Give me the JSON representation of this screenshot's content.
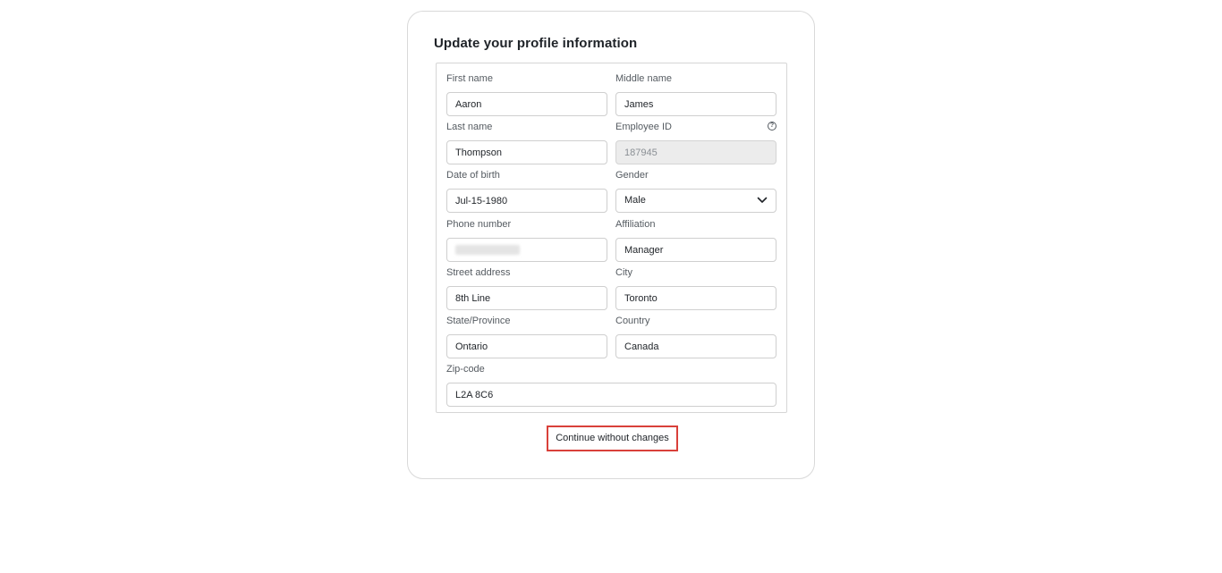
{
  "form": {
    "title": "Update your profile information",
    "first_name": {
      "label": "First name",
      "value": "Aaron"
    },
    "middle_name": {
      "label": "Middle name",
      "value": "James"
    },
    "last_name": {
      "label": "Last name",
      "value": "Thompson"
    },
    "employee_id": {
      "label": "Employee ID",
      "value": "187945",
      "help_icon": "question-circle-icon"
    },
    "date_of_birth": {
      "label": "Date of birth",
      "value": "Jul-15-1980"
    },
    "gender": {
      "label": "Gender",
      "value": "Male",
      "icon": "chevron-down-icon"
    },
    "phone_number": {
      "label": "Phone number",
      "value": ""
    },
    "affiliation": {
      "label": "Affiliation",
      "value": "Manager"
    },
    "street_address": {
      "label": "Street address",
      "value": "8th Line"
    },
    "city": {
      "label": "City",
      "value": "Toronto"
    },
    "state_province": {
      "label": "State/Province",
      "value": "Ontario"
    },
    "country": {
      "label": "Country",
      "value": "Canada"
    },
    "zip_code": {
      "label": "Zip-code",
      "value": "L2A 8C6"
    },
    "continue_label": "Continue without changes"
  },
  "colors": {
    "highlight_border": "#d9403a",
    "disabled_bg": "#ececec"
  }
}
